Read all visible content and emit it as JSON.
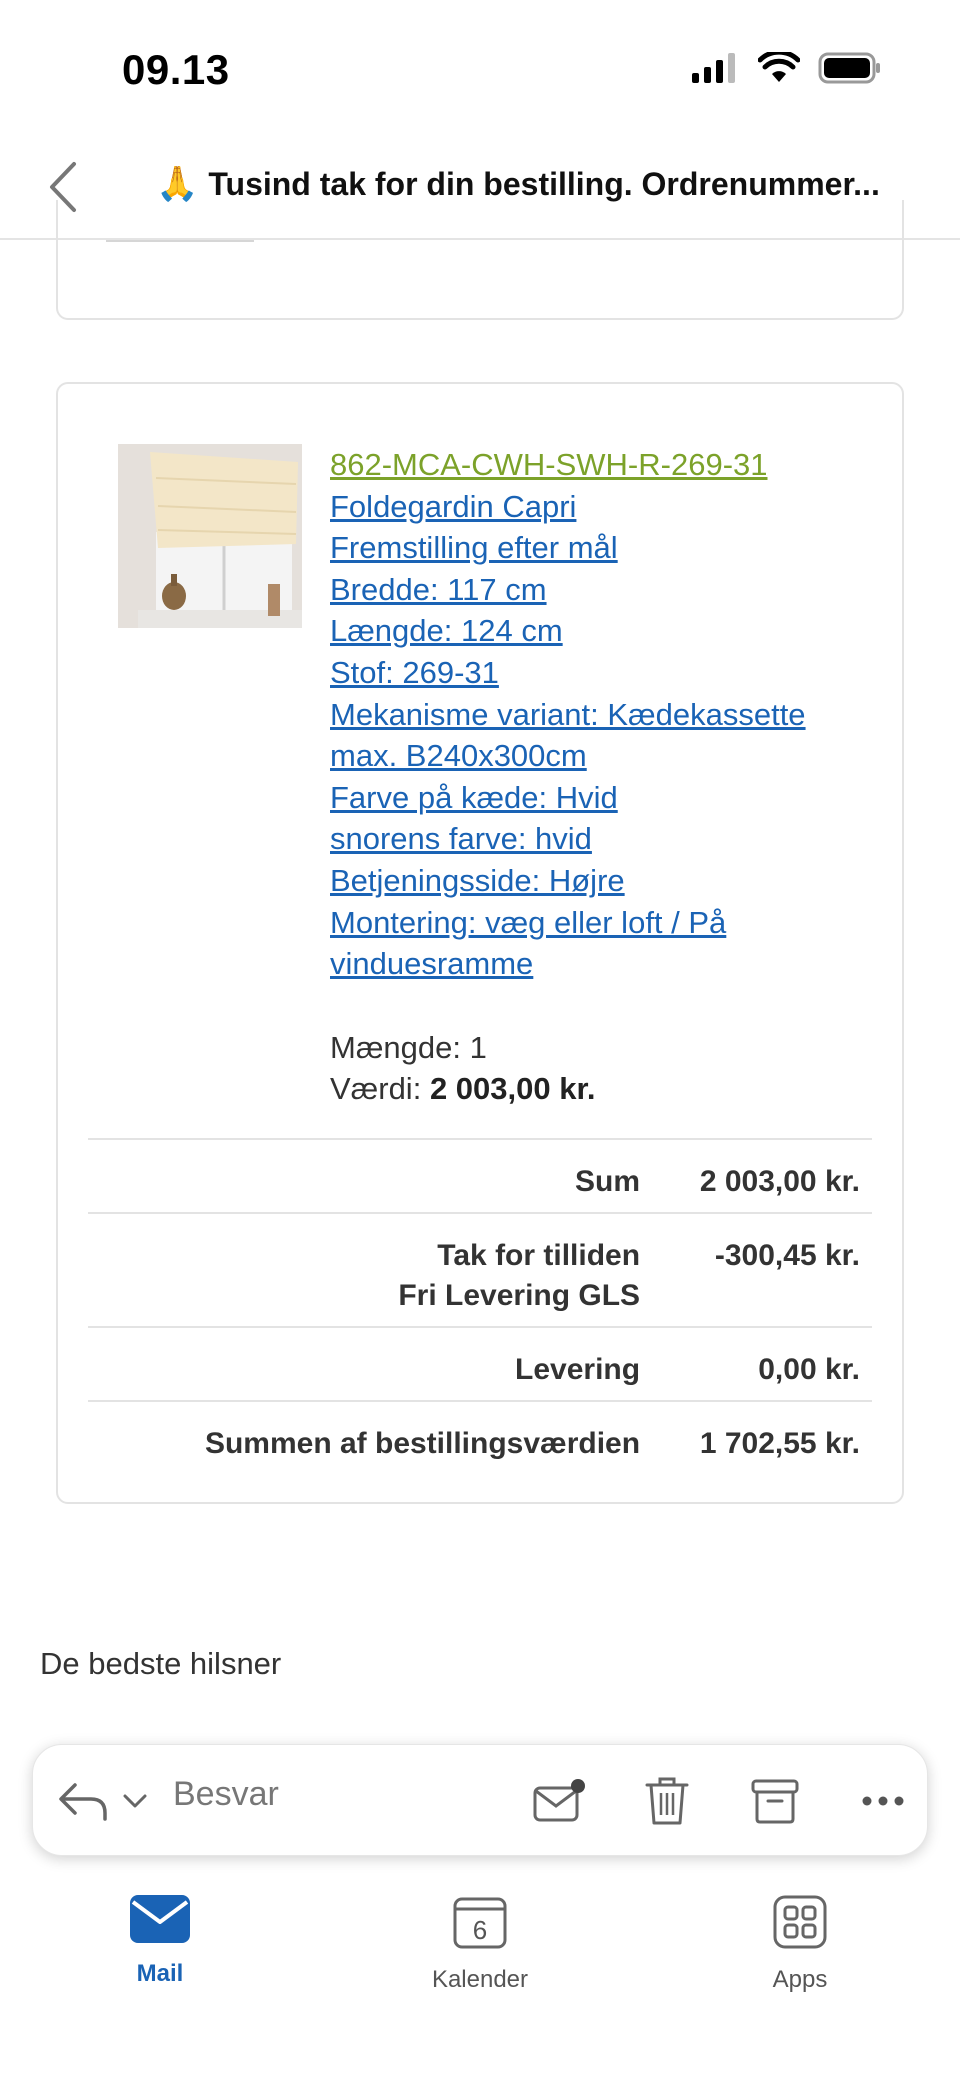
{
  "status_bar": {
    "time": "09.13"
  },
  "header": {
    "back_label": "back",
    "emoji": "🙏",
    "title": "Tusind tak for din bestilling. Ordrenummer..."
  },
  "order": {
    "product": {
      "sku": "862-MCA-CWH-SWH-R-269-31",
      "details": [
        "Foldegardin Capri",
        "Fremstilling efter mål",
        "Bredde: 117 cm",
        "Længde: 124 cm",
        "Stof: 269-31",
        "Mekanisme variant: Kædekassette",
        "max. B240x300cm",
        "Farve på kæde: Hvid",
        "snorens farve: hvid",
        "Betjeningsside: Højre",
        "Montering: væg eller loft / På",
        "vinduesramme"
      ],
      "quantity_label": "Mængde:",
      "quantity": "1",
      "value_label": "Værdi:",
      "value": "2 003,00 kr."
    },
    "totals": [
      {
        "label": "Sum",
        "value": "2 003,00 kr."
      },
      {
        "label": "Tak for tilliden",
        "label2": "Fri Levering GLS",
        "value": "-300,45 kr."
      },
      {
        "label": "Levering",
        "value": "0,00 kr."
      },
      {
        "label": "Summen af bestillingsværdien",
        "value": "1 702,55 kr."
      }
    ]
  },
  "greeting": "De bedste hilsner",
  "action_bar": {
    "reply_placeholder": "Besvar",
    "icons": [
      "reply-icon",
      "chevron-down-icon",
      "mark-unread-icon",
      "trash-icon",
      "archive-icon",
      "more-icon"
    ]
  },
  "tabs": [
    {
      "label": "Mail",
      "icon": "mail-icon",
      "active": true
    },
    {
      "label": "Kalender",
      "icon": "calendar-icon",
      "badge": "6"
    },
    {
      "label": "Apps",
      "icon": "apps-grid-icon"
    }
  ],
  "colors": {
    "link": "#1a63b5",
    "sku_link": "#7ca22a",
    "accent": "#1a63b5"
  }
}
